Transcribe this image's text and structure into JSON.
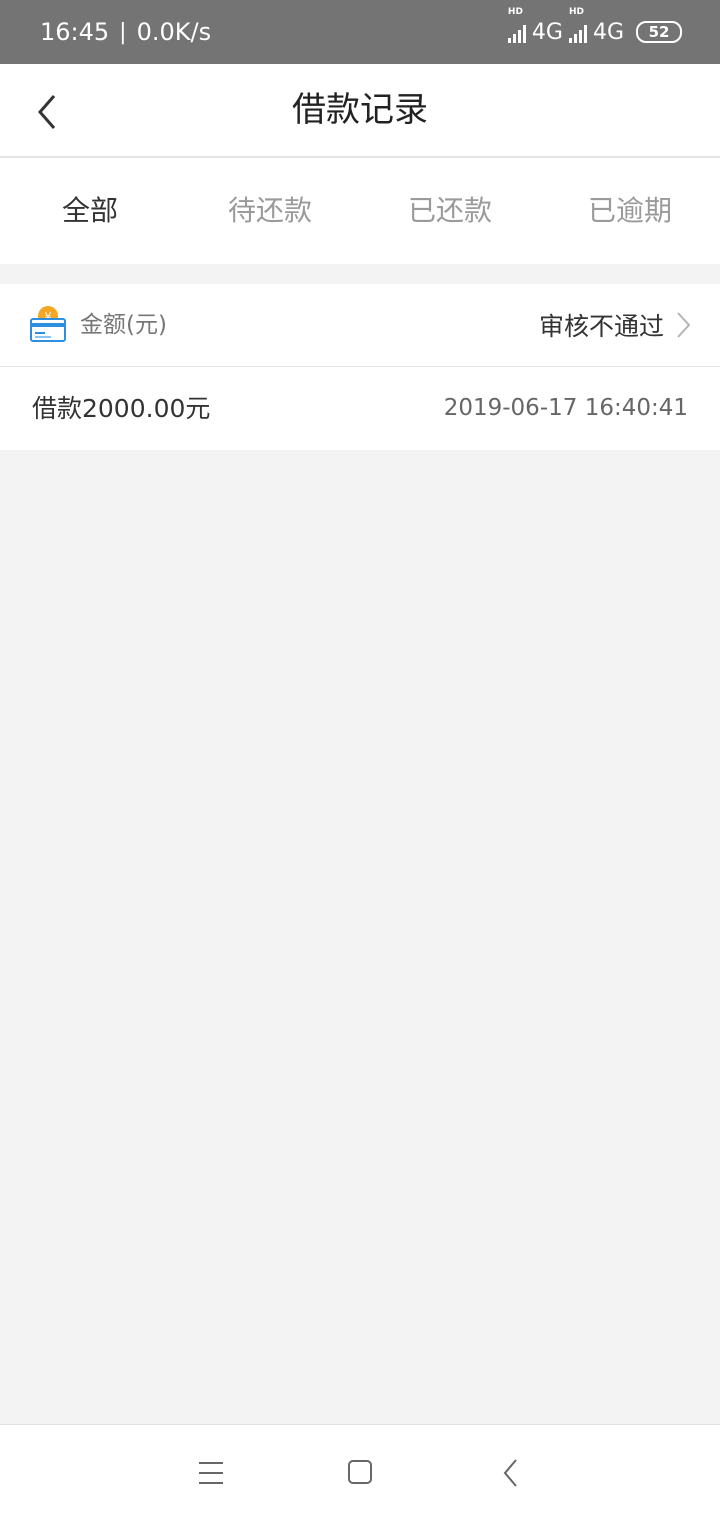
{
  "status_bar": {
    "time": "16:45",
    "separator": "|",
    "speed": "0.0K/s",
    "signal1_label": "HD",
    "network1": "4G",
    "signal2_label": "HD",
    "network2": "4G",
    "battery": "52"
  },
  "header": {
    "title": "借款记录",
    "back_icon": "chevron-left-icon"
  },
  "tabs": [
    {
      "label": "全部",
      "active": true
    },
    {
      "label": "待还款",
      "active": false
    },
    {
      "label": "已还款",
      "active": false
    },
    {
      "label": "已逾期",
      "active": false
    }
  ],
  "record": {
    "amount_label": "金额(元)",
    "status": "审核不通过",
    "description": "借款2000.00元",
    "datetime": "2019-06-17 16:40:41",
    "icon": "wallet-card-icon"
  },
  "colors": {
    "status_bar_bg": "#747474",
    "background": "#f3f3f3",
    "icon_orange": "#f5a623",
    "icon_blue": "#2e8fe0"
  },
  "nav": {
    "menu_icon": "menu-icon",
    "home_icon": "home-square-icon",
    "back_icon": "back-chevron-icon"
  }
}
